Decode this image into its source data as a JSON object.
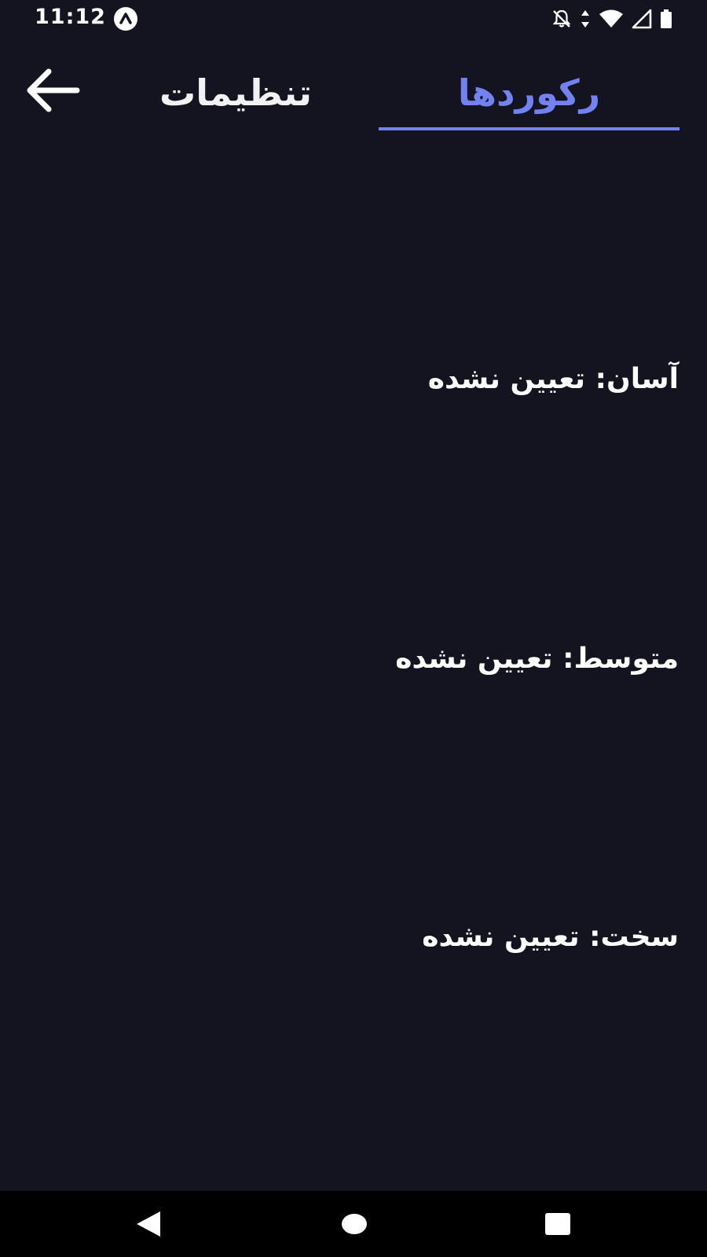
{
  "status_bar": {
    "time": "11:12",
    "icons": [
      "app-notification-icon",
      "notifications-off-icon",
      "data-arrows-icon",
      "wifi-icon",
      "cell-signal-icon",
      "battery-icon"
    ]
  },
  "header": {
    "back_icon": "arrow-left-icon",
    "tabs": [
      {
        "label": "تنظیمات",
        "active": false
      },
      {
        "label": "رکوردها",
        "active": true
      }
    ],
    "accent_color": "#7282f0"
  },
  "records": [
    {
      "text": "آسان: تعیین نشده"
    },
    {
      "text": "متوسط: تعیین نشده"
    },
    {
      "text": "سخت: تعیین نشده"
    }
  ],
  "nav_bar": {
    "icons": [
      "nav-back-icon",
      "nav-home-icon",
      "nav-recents-icon"
    ]
  },
  "colors": {
    "background": "#141420",
    "text": "#ffffff",
    "nav_background": "#000000"
  }
}
